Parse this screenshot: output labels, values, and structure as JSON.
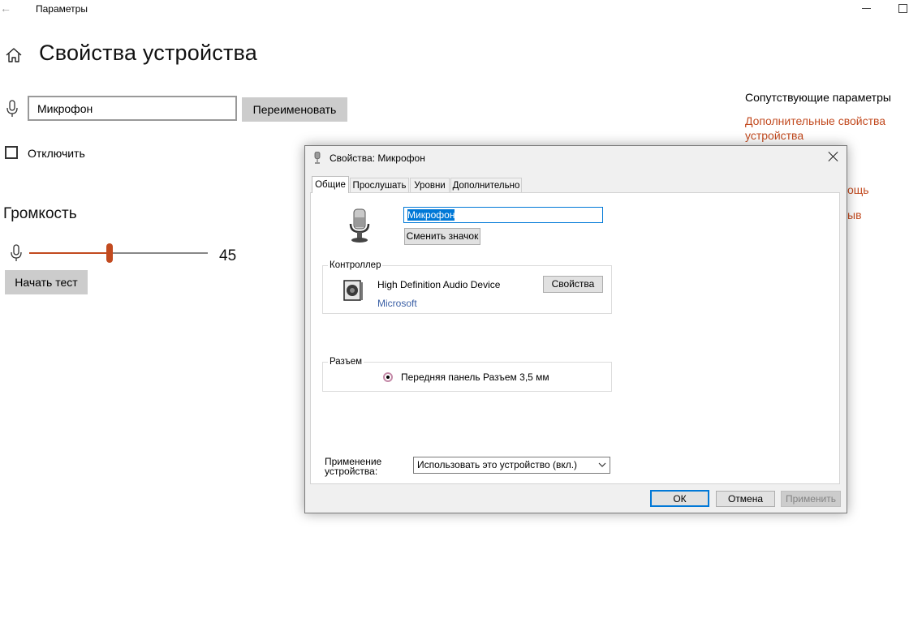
{
  "window": {
    "app_title": "Параметры",
    "back_icon": "back-arrow-icon",
    "minimize_icon": "minimize-icon",
    "maximize_icon": "maximize-icon"
  },
  "page": {
    "title": "Свойства устройства",
    "home_icon": "home-icon"
  },
  "device": {
    "icon": "microphone-icon",
    "name_value": "Микрофон",
    "rename_label": "Переименовать",
    "disable_label": "Отключить",
    "disable_checked": false
  },
  "volume": {
    "heading": "Громкость",
    "value": 45,
    "value_text": "45",
    "test_label": "Начать тест",
    "accent_color": "#c24a1f"
  },
  "related": {
    "title": "Сопутствующие параметры",
    "link_line1": "Дополнительные свойства",
    "link_line2": "устройства",
    "partial_1": "ощь",
    "partial_2": "ыв",
    "link_color": "#c24a1f"
  },
  "dialog": {
    "title": "Свойства: Микрофон",
    "tabs": [
      {
        "label": "Общие",
        "active": true
      },
      {
        "label": "Прослушать",
        "active": false
      },
      {
        "label": "Уровни",
        "active": false
      },
      {
        "label": "Дополнительно",
        "active": false
      }
    ],
    "device_name_value": "Микрофон",
    "change_icon_label": "Сменить значок",
    "controller": {
      "group_label": "Контроллер",
      "device_name": "High Definition Audio Device",
      "vendor": "Microsoft",
      "properties_label": "Свойства"
    },
    "jack": {
      "group_label": "Разъем",
      "location": "Передняя панель Разъем 3,5 мм"
    },
    "usage": {
      "label_line1": "Применение",
      "label_line2": "устройства:",
      "selected": "Использовать это устройство (вкл.)"
    },
    "buttons": {
      "ok": "ОК",
      "cancel": "Отмена",
      "apply": "Применить"
    }
  }
}
